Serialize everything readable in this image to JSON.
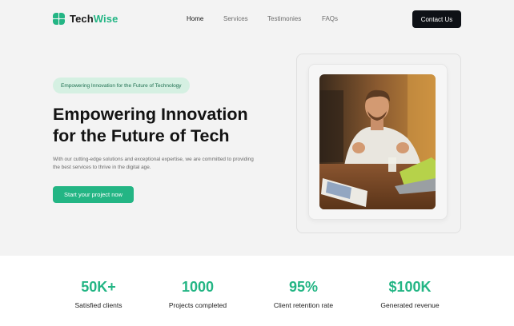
{
  "brand": {
    "name_part1": "Tech",
    "name_part2": "Wise",
    "accent_color": "#23b584"
  },
  "nav": {
    "items": [
      {
        "label": "Home",
        "active": true
      },
      {
        "label": "Services",
        "active": false
      },
      {
        "label": "Testimonies",
        "active": false
      },
      {
        "label": "FAQs",
        "active": false
      }
    ],
    "contact_label": "Contact Us"
  },
  "hero": {
    "badge": "Empowering Innovation for the Future of Technology",
    "headline_line1": "Empowering Innovation",
    "headline_line2": "for the Future of Tech",
    "description": "With our cutting-edge solutions and exceptional expertise, we are committed to providing the best services to thrive in the digital age.",
    "cta_label": "Start your project now"
  },
  "stats": [
    {
      "value": "50K+",
      "label": "Satisfied clients"
    },
    {
      "value": "1000",
      "label": "Projects completed"
    },
    {
      "value": "95%",
      "label": "Client retention rate"
    },
    {
      "value": "$100K",
      "label": "Generated revenue"
    }
  ]
}
